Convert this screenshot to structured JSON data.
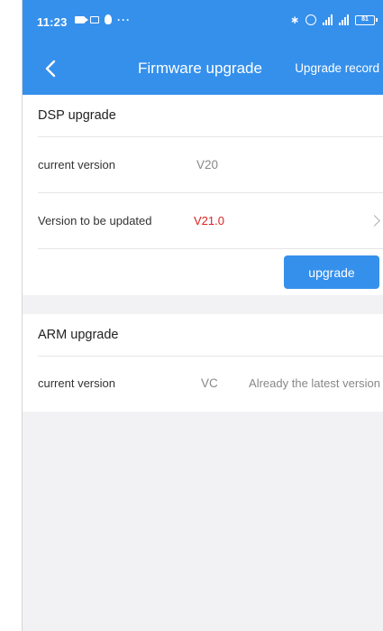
{
  "status_bar": {
    "time": "11:23",
    "left_icons": [
      "video-icon",
      "message-icon",
      "fire-icon",
      "more-dots-icon"
    ],
    "right_icons": [
      "bluetooth-icon",
      "alarm-icon",
      "signal-icon",
      "signal-icon",
      "battery-icon"
    ],
    "battery_text": "81"
  },
  "nav": {
    "back_icon": "chevron-left-icon",
    "title": "Firmware upgrade",
    "record_link": "Upgrade record"
  },
  "dsp": {
    "title": "DSP upgrade",
    "current_label": "current version",
    "current_value": "V20",
    "update_label": "Version to be updated",
    "update_value": "V21.0",
    "upgrade_button": "upgrade",
    "accent_color": "#e02020"
  },
  "arm": {
    "title": "ARM upgrade",
    "current_label": "current version",
    "current_value": "VC",
    "status_text": "Already the latest version"
  },
  "colors": {
    "primary": "#3590ec",
    "background": "#f2f2f4"
  }
}
